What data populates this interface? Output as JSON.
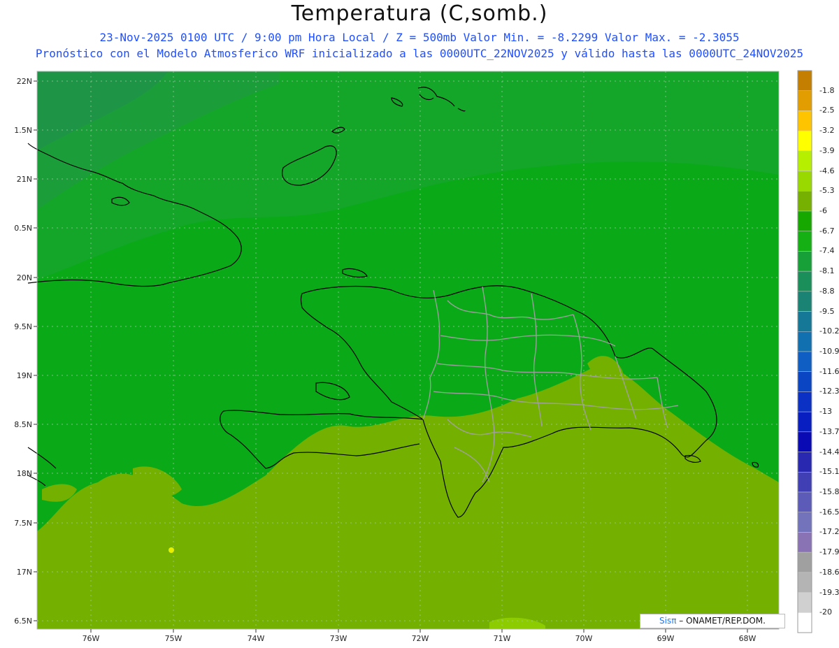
{
  "title": "Temperatura (C,somb.)",
  "subtitle_line1": "23-Nov-2025  0100 UTC / 9:00 pm Hora Local / Z = 500mb   Valor Min. = -8.2299  Valor Max. = -2.3055",
  "subtitle_line2": "Pronóstico con el Modelo Atmosferico WRF inicializado a las 0000UTC_22NOV2025 y válido hasta las  0000UTC_24NOV2025",
  "lat_labels": [
    "22N",
    "1.5N",
    "21N",
    "0.5N",
    "20N",
    "9.5N",
    "19N",
    "8.5N",
    "18N",
    "7.5N",
    "17N",
    "6.5N"
  ],
  "lon_labels": [
    "76W",
    "75W",
    "74W",
    "73W",
    "72W",
    "71W",
    "70W",
    "69W",
    "68W"
  ],
  "colorbar": {
    "labels": [
      "-1.8",
      "-2.5",
      "-3.2",
      "-3.9",
      "-4.6",
      "-5.3",
      "-6",
      "-6.7",
      "-7.4",
      "-8.1",
      "-8.8",
      "-9.5",
      "-10.2",
      "-10.9",
      "-11.6",
      "-12.3",
      "-13",
      "-13.7",
      "-14.4",
      "-15.1",
      "-15.8",
      "-16.5",
      "-17.2",
      "-17.9",
      "-18.6",
      "-19.3",
      "-20"
    ],
    "colors": [
      "#c47e00",
      "#e29e00",
      "#ffc400",
      "#ffff00",
      "#b6f000",
      "#9ad900",
      "#76b000",
      "#17a800",
      "#14b014",
      "#18a038",
      "#1a8f5a",
      "#1a8374",
      "#157896",
      "#1170b0",
      "#0f5ec4",
      "#0a46c4",
      "#0a30c4",
      "#081ec0",
      "#0a0ab4",
      "#2828b0",
      "#4040b4",
      "#5c5cb8",
      "#7373bc",
      "#8a73b4",
      "#a0a0a0",
      "#b4b4b4",
      "#d0d0d0",
      "#ffffff"
    ]
  },
  "credit": {
    "sis": "Sisπ",
    "text": " – ONAMET/REP.DOM."
  }
}
